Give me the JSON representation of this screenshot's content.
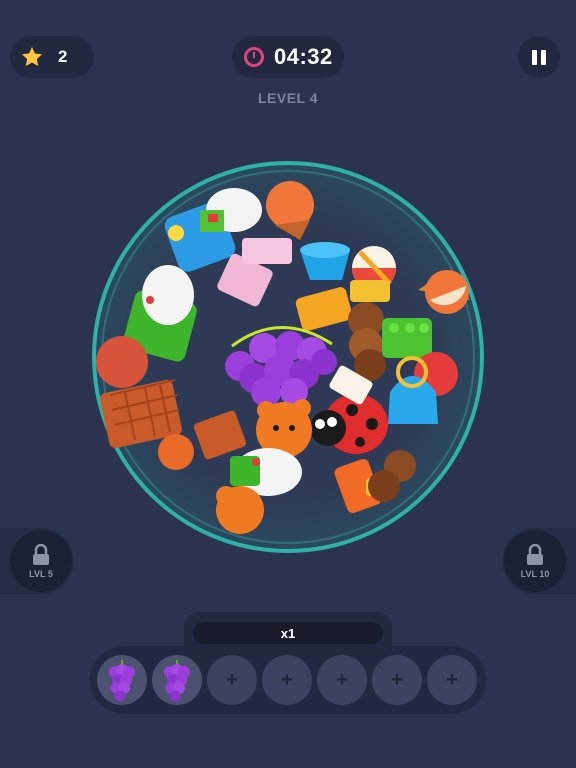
{
  "hud": {
    "stars": "2",
    "timer": "04:32",
    "level": "LEVEL 4"
  },
  "locks": {
    "left": "LVL 5",
    "right": "LVL 10"
  },
  "tray": {
    "multiplier": "x1",
    "slots": [
      {
        "item": "grapes-icon",
        "label": ""
      },
      {
        "item": "grapes-icon",
        "label": ""
      },
      {
        "item": "empty",
        "label": "+"
      },
      {
        "item": "empty",
        "label": "+"
      },
      {
        "item": "empty",
        "label": "+"
      },
      {
        "item": "empty",
        "label": "+"
      },
      {
        "item": "empty",
        "label": "+"
      }
    ]
  },
  "colors": {
    "background": "#2c3350",
    "bowl_rim": "#2fd8c4",
    "star": "#ffc53d",
    "timer_icon": "#e2457e",
    "grapes": "#9b3fdc"
  }
}
